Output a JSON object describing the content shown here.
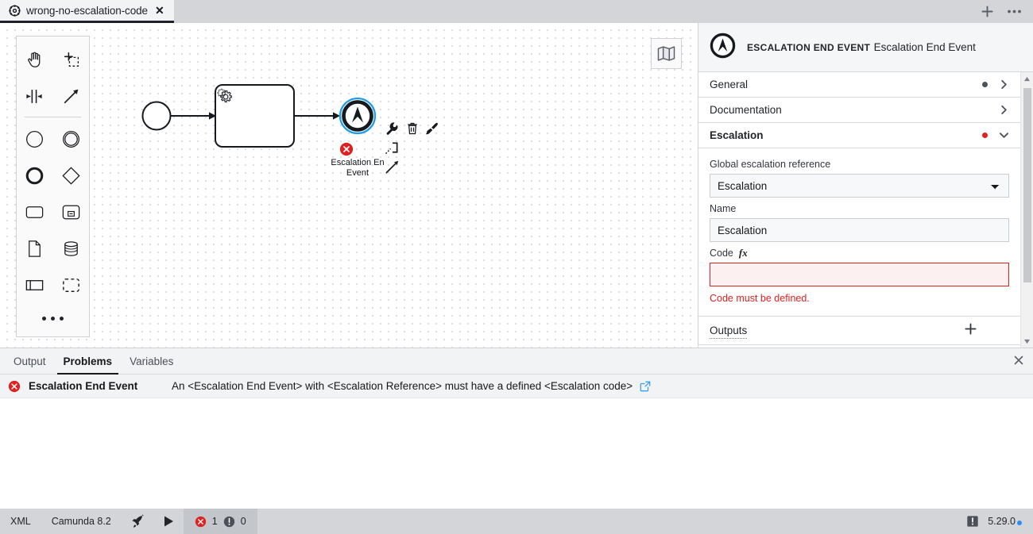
{
  "app": {
    "version": "5.29.0"
  },
  "tabbar": {
    "tab": {
      "icon": "bpmn-diagram-icon",
      "title": "wrong-no-escalation-code",
      "close_label": "✕"
    },
    "new_tab_label": "+",
    "more_label": "⋯"
  },
  "canvas": {
    "palette": {
      "tools": [
        {
          "name": "hand-tool",
          "label": "Activate the hand tool"
        },
        {
          "name": "lasso-tool",
          "label": "Activate the lasso tool"
        },
        {
          "name": "space-tool",
          "label": "Activate the create/remove space tool"
        },
        {
          "name": "global-connect-tool",
          "label": "Activate the global connect tool"
        }
      ],
      "elements": [
        {
          "name": "create-start-event",
          "label": "Create start event"
        },
        {
          "name": "create-intermediate-event",
          "label": "Create intermediate/boundary event"
        },
        {
          "name": "create-end-event",
          "label": "Create end event"
        },
        {
          "name": "create-gateway",
          "label": "Create gateway"
        },
        {
          "name": "create-task",
          "label": "Create task"
        },
        {
          "name": "create-subprocess",
          "label": "Create expanded sub-process"
        },
        {
          "name": "create-data-object",
          "label": "Create data object reference"
        },
        {
          "name": "create-data-store",
          "label": "Create data store reference"
        },
        {
          "name": "create-participant",
          "label": "Create pool/participant"
        },
        {
          "name": "create-group",
          "label": "Create group"
        }
      ],
      "more_label": "•••"
    },
    "minimap_toggle_label": "Toggle minimap",
    "shapes": {
      "start_event": {
        "name": "start-event",
        "label": ""
      },
      "service_task": {
        "name": "service-task",
        "label": ""
      },
      "end_event": {
        "name": "escalation-end-event",
        "label": "Escalation End Event",
        "label_line1": "Escalation En",
        "label_line2": "Event",
        "has_error": true
      }
    },
    "context_pad": [
      {
        "name": "append-task-wrench",
        "label": "Change element"
      },
      {
        "name": "delete-trash",
        "label": "Remove"
      },
      {
        "name": "set-color-paintbrush",
        "label": "Set color"
      },
      {
        "name": "connect-tool",
        "label": "Connect"
      },
      {
        "name": "append-arrow",
        "label": "Append element"
      }
    ]
  },
  "properties": {
    "header": {
      "icon": "escalation-end-event-icon",
      "type": "ESCALATION END EVENT",
      "name": "Escalation End Event"
    },
    "groups": [
      {
        "id": "general",
        "title": "General",
        "marker": "grey",
        "expanded": false
      },
      {
        "id": "documentation",
        "title": "Documentation",
        "marker": "none",
        "expanded": false
      },
      {
        "id": "escalation",
        "title": "Escalation",
        "marker": "red",
        "expanded": true
      }
    ],
    "escalation": {
      "global_ref": {
        "label": "Global escalation reference",
        "value": "Escalation",
        "options": [
          "Escalation"
        ]
      },
      "name": {
        "label": "Name",
        "value": "Escalation",
        "placeholder": ""
      },
      "code": {
        "label": "Code",
        "fx_label": "fx",
        "value": "",
        "placeholder": "",
        "error": "Code must be defined."
      }
    },
    "outputs": {
      "label": "Outputs",
      "add_label": "+"
    },
    "markers": {
      "grey": "#4d525c",
      "red": "#e02121"
    }
  },
  "bottom_panel": {
    "tabs": [
      {
        "id": "output",
        "label": "Output",
        "active": false
      },
      {
        "id": "problems",
        "label": "Problems",
        "active": true
      },
      {
        "id": "variables",
        "label": "Variables",
        "active": false
      }
    ],
    "close_label": "✕",
    "problems": [
      {
        "severity": "error",
        "element": "Escalation End Event",
        "message": "An <Escalation End Event> with <Escalation Reference> must have a defined <Escalation code>",
        "link_label": "Open documentation"
      }
    ]
  },
  "status_bar": {
    "xml_label": "XML",
    "engine_label": "Camunda 8.2",
    "deploy_label": "Deploy current diagram",
    "run_label": "Start current diagram",
    "error_count": "1",
    "warning_count": "0",
    "notifications_label": "Notifications",
    "version": "5.29.0"
  },
  "colors": {
    "accent_blue": "#2c8ff0",
    "error_red": "#e02121",
    "selection_blue": "#1a9cf0",
    "chrome_grey": "#d3d5d9"
  }
}
